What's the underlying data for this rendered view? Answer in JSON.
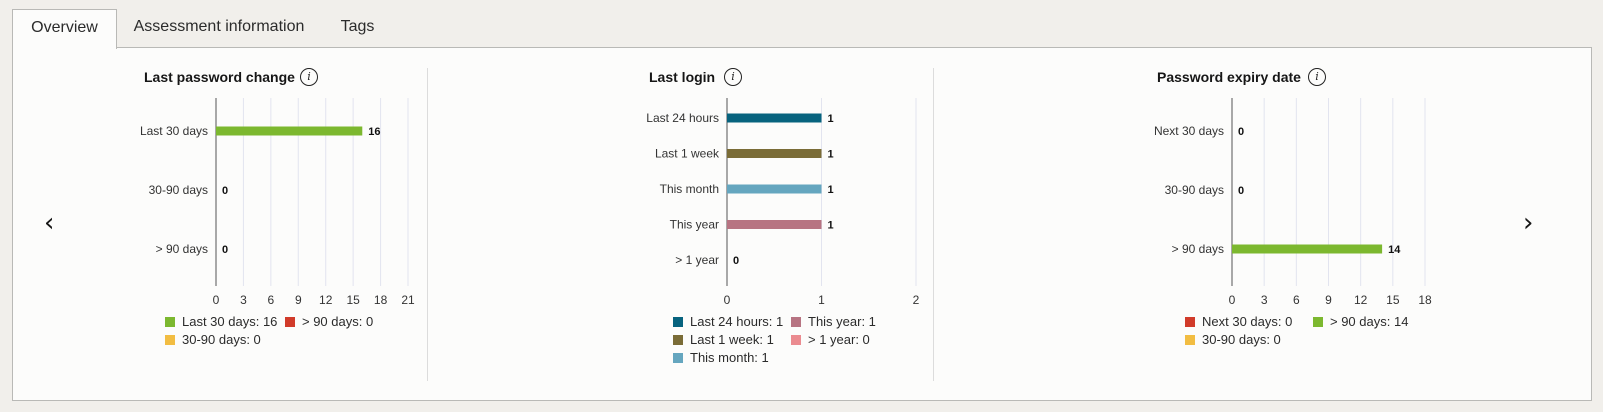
{
  "tabs": [
    {
      "label": "Overview",
      "active": true
    },
    {
      "label": "Assessment information",
      "active": false
    },
    {
      "label": "Tags",
      "active": false
    }
  ],
  "nav": {
    "prev_glyph": "‹",
    "next_glyph": "›"
  },
  "info_glyph": "i",
  "chart_data": [
    {
      "type": "bar",
      "orientation": "horizontal",
      "title": "Last password change",
      "categories": [
        "Last 30 days",
        "30-90 days",
        "> 90 days"
      ],
      "values": [
        16,
        0,
        0
      ],
      "colors": [
        "#7cb82f",
        "#f2bd42",
        "#d13b2a"
      ],
      "xticks": [
        "0",
        "3",
        "6",
        "9",
        "12",
        "15",
        "18",
        "21"
      ],
      "xlim": [
        0,
        21
      ],
      "grid": true,
      "legend": [
        {
          "label": "Last 30 days: 16",
          "color": "#7cb82f"
        },
        {
          "label": "> 90 days: 0",
          "color": "#d13b2a"
        },
        {
          "label": "30-90 days: 0",
          "color": "#f2bd42"
        }
      ]
    },
    {
      "type": "bar",
      "orientation": "horizontal",
      "title": "Last login",
      "categories": [
        "Last 24 hours",
        "Last 1 week",
        "This month",
        "This year",
        "> 1 year"
      ],
      "values": [
        1,
        1,
        1,
        1,
        0
      ],
      "colors": [
        "#07637e",
        "#7a6c37",
        "#65a6bf",
        "#b77482",
        "#eb8b90"
      ],
      "xticks": [
        "0",
        "1",
        "2"
      ],
      "xlim": [
        0,
        2
      ],
      "grid": true,
      "legend": [
        {
          "label": "Last 24 hours: 1",
          "color": "#07637e"
        },
        {
          "label": "This year: 1",
          "color": "#b77482"
        },
        {
          "label": "Last 1 week: 1",
          "color": "#7a6c37"
        },
        {
          "label": "> 1 year: 0",
          "color": "#eb8b90"
        },
        {
          "label": "This month: 1",
          "color": "#65a6bf"
        }
      ]
    },
    {
      "type": "bar",
      "orientation": "horizontal",
      "title": "Password expiry date",
      "categories": [
        "Next 30 days",
        "30-90 days",
        "> 90 days"
      ],
      "values": [
        0,
        0,
        14
      ],
      "colors": [
        "#d13b2a",
        "#f2bd42",
        "#7cb82f"
      ],
      "xticks": [
        "0",
        "3",
        "6",
        "9",
        "12",
        "15",
        "18"
      ],
      "xlim": [
        0,
        18
      ],
      "grid": true,
      "legend": [
        {
          "label": "Next 30 days: 0",
          "color": "#d13b2a"
        },
        {
          "label": "> 90 days: 14",
          "color": "#7cb82f"
        },
        {
          "label": "30-90 days: 0",
          "color": "#f2bd42"
        }
      ]
    }
  ]
}
